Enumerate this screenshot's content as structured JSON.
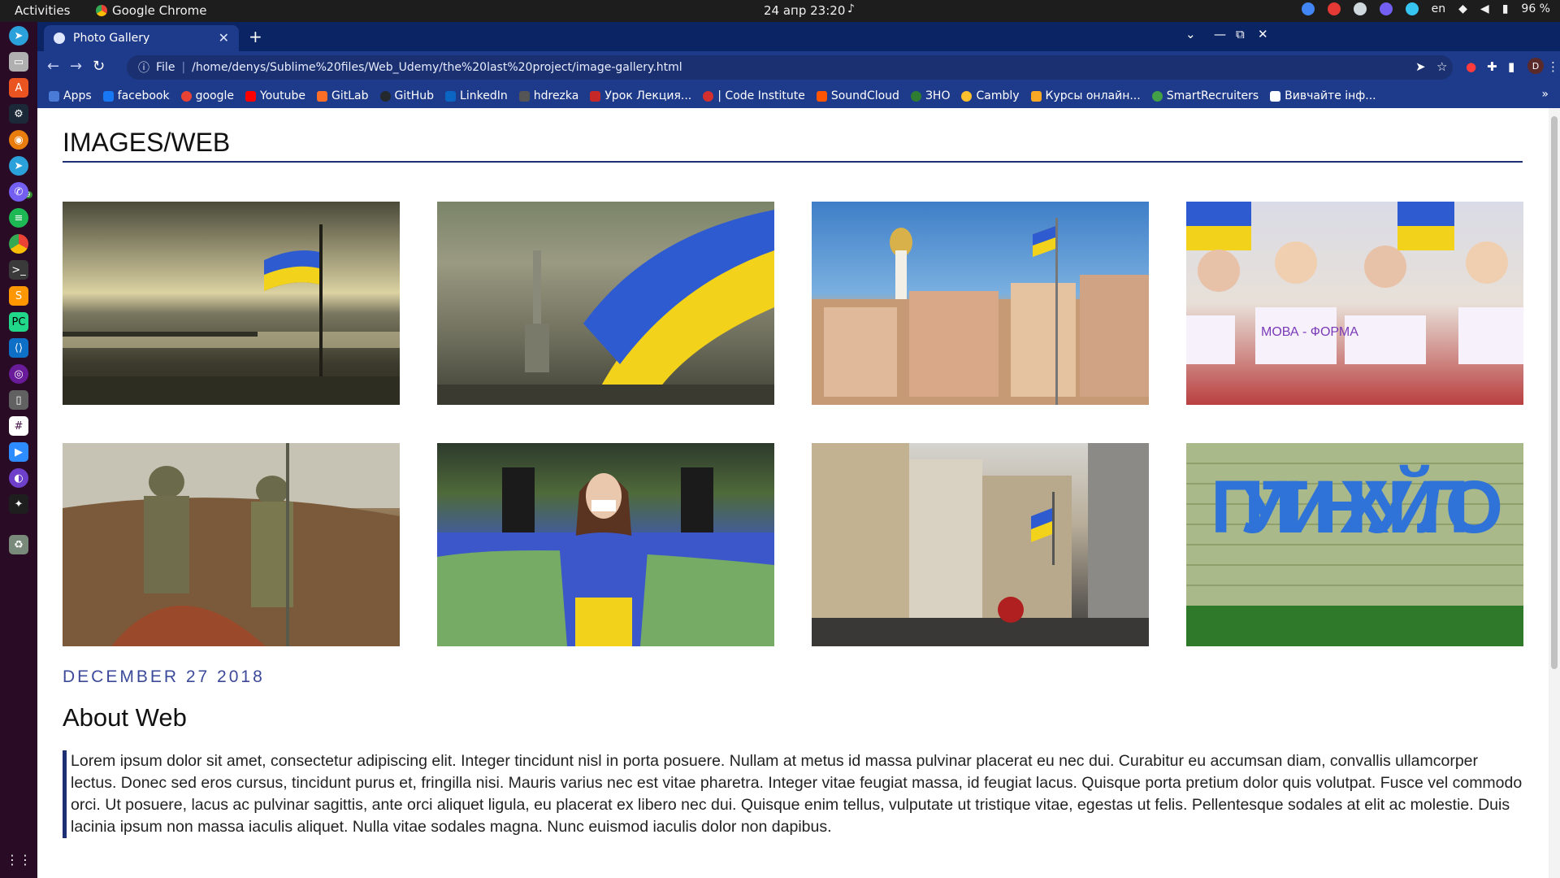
{
  "system_bar": {
    "activities": "Activities",
    "app_name": "Google Chrome",
    "clock": "24 апр  23:20",
    "lang": "en",
    "battery": "96 %"
  },
  "browser": {
    "tab_title": "Photo Gallery",
    "url_scheme": "File",
    "url": "/home/denys/Sublime%20files/Web_Udemy/the%20last%20project/image-gallery.html",
    "profile_initial": "D",
    "bookmarks": [
      {
        "label": "Apps",
        "color": "#4a7bd6"
      },
      {
        "label": "facebook",
        "color": "#1877f2"
      },
      {
        "label": "google",
        "color": "#ea4335"
      },
      {
        "label": "Youtube",
        "color": "#ff0000"
      },
      {
        "label": "GitLab",
        "color": "#fc6d26"
      },
      {
        "label": "GitHub",
        "color": "#24292e"
      },
      {
        "label": "LinkedIn",
        "color": "#0a66c2"
      },
      {
        "label": "hdrezka",
        "color": "#555555"
      },
      {
        "label": "Урок Лекция...",
        "color": "#c62828"
      },
      {
        "label": "| Code Institute",
        "color": "#d32f2f"
      },
      {
        "label": "SoundCloud",
        "color": "#ff5500"
      },
      {
        "label": "ЗНО",
        "color": "#2e7d32"
      },
      {
        "label": "Cambly",
        "color": "#fbc02d"
      },
      {
        "label": "Курсы онлайн...",
        "color": "#f9a825"
      },
      {
        "label": "SmartRecruiters",
        "color": "#43a047"
      },
      {
        "label": "Вивчайте інф...",
        "color": "#ffffff"
      }
    ]
  },
  "page": {
    "heading": "IMAGES/WEB",
    "date": "DECEMBER 27 2018",
    "about_heading": "About Web",
    "about_text": "Lorem ipsum dolor sit amet, consectetur adipiscing elit. Integer tincidunt nisl in porta posuere. Nullam at metus id massa pulvinar placerat eu nec dui. Curabitur eu accumsan diam, convallis ullamcorper lectus. Donec sed eros cursus, tincidunt purus et, fringilla nisi. Mauris varius nec est vitae pharetra. Integer vitae feugiat massa, id feugiat lacus. Quisque porta pretium dolor quis volutpat. Fusce vel commodo orci. Ut posuere, lacus ac pulvinar sagittis, ante orci aliquet ligula, eu placerat ex libero nec dui. Quisque enim tellus, vulputate ut tristique vitae, egestas ut felis. Pellentesque sodales at elit ac molestie. Duis lacinia ipsum non massa iaculis aliquet. Nulla vitae sodales magna. Nunc euismod iaculis dolor non dapibus.",
    "gallery": [
      {
        "name": "flag-over-river-photo"
      },
      {
        "name": "motherland-monument-flag-photo"
      },
      {
        "name": "kyiv-city-square-photo"
      },
      {
        "name": "protest-signs-photo",
        "caption": "МОВА - ФОРМА"
      },
      {
        "name": "soldiers-trench-photo"
      },
      {
        "name": "girl-with-flag-photo"
      },
      {
        "name": "old-town-street-photo"
      },
      {
        "name": "graffiti-wall-photo",
        "caption": "ПУТИН ХУЙЛО"
      }
    ]
  },
  "colors": {
    "accent": "#1e2f74",
    "date_color": "#3c4a99",
    "chrome_frame": "#0b2463",
    "chrome_toolbar": "#1e3a8a",
    "flag_blue": "#2f5bd1",
    "flag_yellow": "#f2d21a"
  }
}
